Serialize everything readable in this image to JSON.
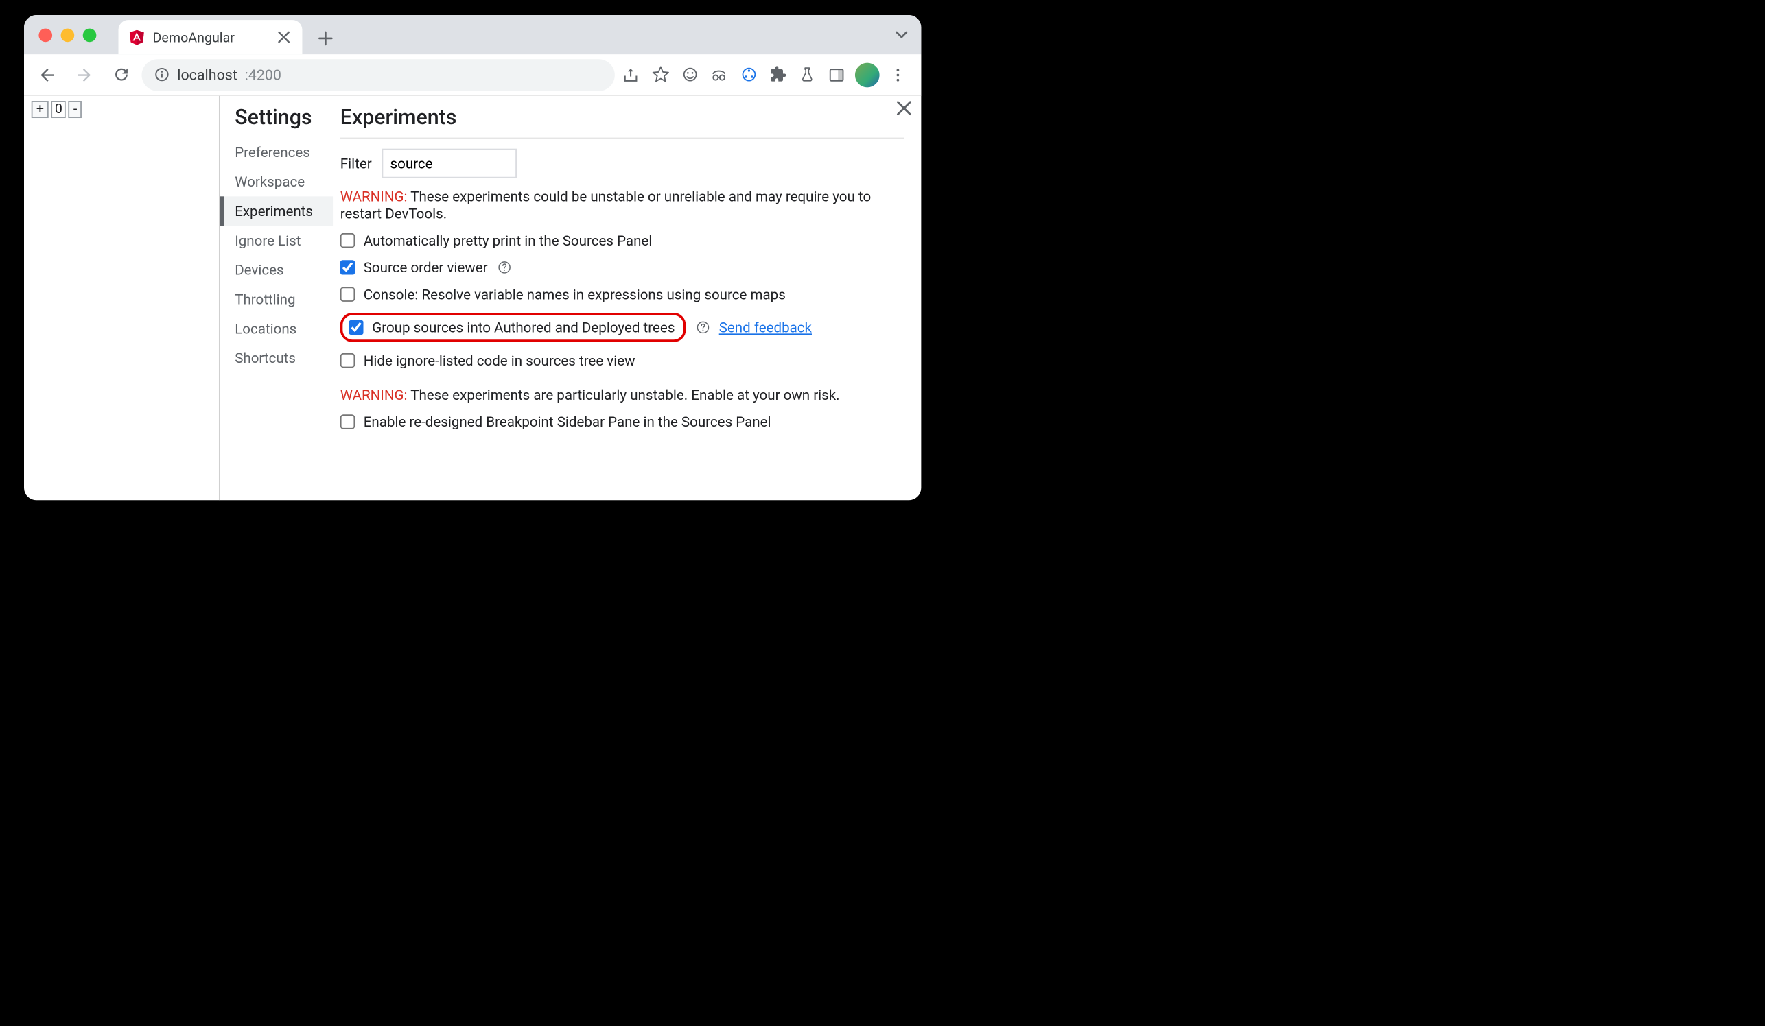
{
  "browser": {
    "tab_title": "DemoAngular",
    "url_host": "localhost",
    "url_port": ":4200"
  },
  "counter": {
    "plus": "+",
    "value": "0",
    "minus": "-"
  },
  "settings": {
    "title": "Settings",
    "nav": {
      "preferences": "Preferences",
      "workspace": "Workspace",
      "experiments": "Experiments",
      "ignore_list": "Ignore List",
      "devices": "Devices",
      "throttling": "Throttling",
      "locations": "Locations",
      "shortcuts": "Shortcuts"
    }
  },
  "experiments": {
    "title": "Experiments",
    "filter_label": "Filter",
    "filter_value": "source",
    "warning1_label": "WARNING:",
    "warning1_text": " These experiments could be unstable or unreliable and may require you to restart DevTools.",
    "warning2_label": "WARNING:",
    "warning2_text": " These experiments are particularly unstable. Enable at your own risk.",
    "items": {
      "pretty_print": {
        "label": "Automatically pretty print in the Sources Panel",
        "checked": false
      },
      "source_order": {
        "label": "Source order viewer",
        "checked": true
      },
      "console_resolve": {
        "label": "Console: Resolve variable names in expressions using source maps",
        "checked": false
      },
      "group_sources": {
        "label": "Group sources into Authored and Deployed trees",
        "checked": true
      },
      "hide_ignore": {
        "label": "Hide ignore-listed code in sources tree view",
        "checked": false
      },
      "breakpoint_sidebar": {
        "label": "Enable re-designed Breakpoint Sidebar Pane in the Sources Panel",
        "checked": false
      }
    },
    "send_feedback": "Send feedback"
  }
}
